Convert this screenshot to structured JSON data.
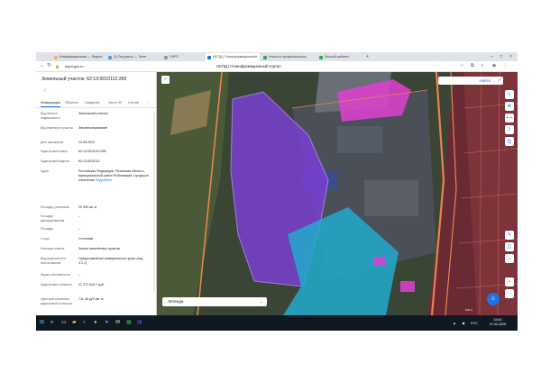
{
  "browser": {
    "tabs": [
      {
        "label": "Информационная — Яндекс",
        "active": false,
        "color": "#f6b26b"
      },
      {
        "label": "(1) Загрузить — Телег",
        "active": false,
        "color": "#4aa3df"
      },
      {
        "label": "ГИРО",
        "active": false,
        "color": "#999999"
      },
      {
        "label": "НСПД | Геоинформационный",
        "active": true,
        "color": "#1a73e8"
      },
      {
        "label": "Новости профессионала",
        "active": false,
        "color": "#34a853"
      },
      {
        "label": "Личный кабинет",
        "active": false,
        "color": "#34a853"
      }
    ],
    "url": "nspd.gov.ru",
    "page_title": "НСПД | Геоинформационный портал"
  },
  "panel": {
    "title": "Земельный участок: 62:13:0010112:390",
    "tabs": [
      "Информация",
      "Объекты",
      "Сведения",
      "Части ЗУ",
      "Состав"
    ],
    "active_tab": 0,
    "rows": [
      {
        "key": "Вид объекта недвижимости",
        "value": "Земельный участок"
      },
      {
        "key": "Вид земельного участка",
        "value": "Землепользование"
      },
      {
        "key": "Дата присвоения",
        "value": "14.09.2023"
      },
      {
        "key": "Кадастровый номер",
        "value": "62:13:0010112:390"
      },
      {
        "key": "Кадастровый квартал",
        "value": "62:13:0010112"
      },
      {
        "key": "Адрес",
        "value": "Российская Федерация, Рязанская область, муниципальный район Рыбновский, городское поселение",
        "link": "Подробнее"
      },
      {
        "key": "Площадь уточненная",
        "value": "29 900 кв. м"
      },
      {
        "key": "Площадь декларированная",
        "value": "–"
      },
      {
        "key": "Площадь",
        "value": "–"
      },
      {
        "key": "Статус",
        "value": "Учтенный"
      },
      {
        "key": "Категория земель",
        "value": "Земли населённых пунктов"
      },
      {
        "key": "Вид разрешенного использования",
        "value": "Предоставление коммунальных услуг (код 3.1.1)"
      },
      {
        "key": "Форма собственности",
        "value": "–"
      },
      {
        "key": "Кадастровая стоимость",
        "value": "21 272 633,7 руб."
      },
      {
        "key": "Удельный показатель кадастровой стоимости",
        "value": "711,46 руб./кв. м"
      }
    ]
  },
  "map": {
    "search_label": "Найти",
    "legend_label": "Легенда",
    "scale_text": "100 м",
    "colors": {
      "selected_parcel": "#7b3fd8",
      "magenta_parcel": "#e040d0",
      "cyan_parcel": "#22aacc",
      "road": "#e8844a",
      "industrial": "#4a4f58",
      "residential": "#7a2230"
    }
  },
  "taskbar": {
    "time": "15:40",
    "date": "07.02.2025"
  }
}
